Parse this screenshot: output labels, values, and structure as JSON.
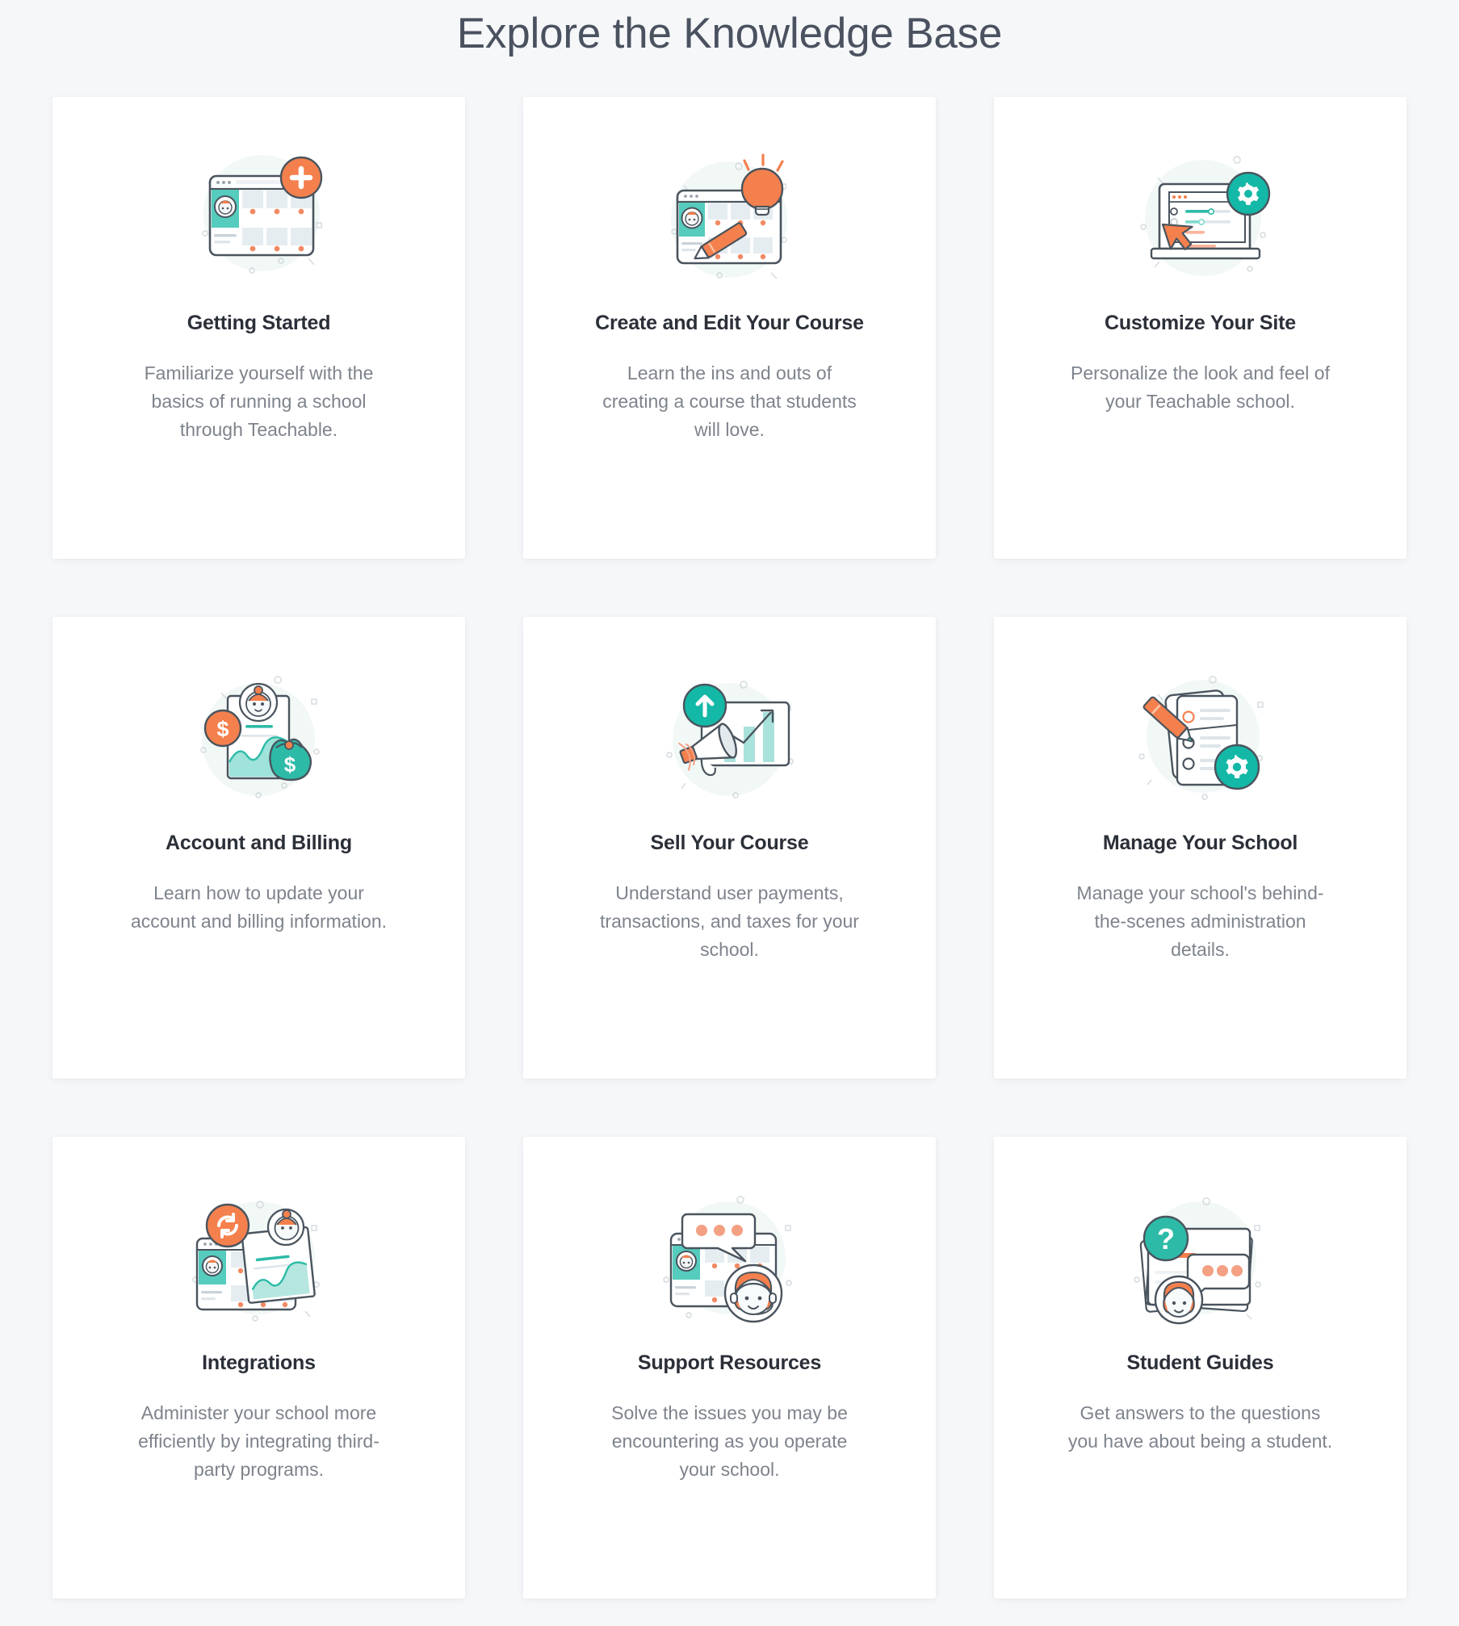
{
  "page": {
    "title": "Explore the Knowledge Base",
    "background_color": "#f6f7f9",
    "card_background_color": "#ffffff",
    "title_color": "#4a5260",
    "card_title_color": "#2b2f38",
    "card_desc_color": "#7e838c",
    "accent_orange": "#f4804d",
    "accent_teal": "#2dbba7",
    "accent_light_teal": "#7fd9cd",
    "outline_color": "#4a545e"
  },
  "cards": [
    {
      "title": "Getting Started",
      "description": "Familiarize yourself with the basics of running a school through Teachable.",
      "icon": "browser-window-with-plus-badge-illustration"
    },
    {
      "title": "Create and Edit Your Course",
      "description": "Learn the ins and outs of creating a course that students will love.",
      "icon": "browser-window-with-pencil-and-lightbulb-illustration"
    },
    {
      "title": "Customize Your Site",
      "description": "Personalize the look and feel of your Teachable school.",
      "icon": "laptop-with-gear-badge-and-cursor-illustration"
    },
    {
      "title": "Account and Billing",
      "description": "Learn how to update your account and billing information.",
      "icon": "invoice-with-coin-and-money-bag-illustration"
    },
    {
      "title": "Sell Your Course",
      "description": "Understand user payments, transactions, and taxes for your school.",
      "icon": "megaphone-with-growth-chart-and-up-arrow-badge-illustration"
    },
    {
      "title": "Manage Your School",
      "description": "Manage your school's behind-the-scenes administration details.",
      "icon": "clipboard-with-pencil-and-gear-badge-illustration"
    },
    {
      "title": "Integrations",
      "description": "Administer your school more efficiently by integrating third-party programs.",
      "icon": "browser-window-with-chart-document-and-sync-badge-illustration"
    },
    {
      "title": "Support Resources",
      "description": "Solve the issues you may be encountering as you operate your school.",
      "icon": "browser-window-with-speech-bubble-and-support-agent-illustration"
    },
    {
      "title": "Student Guides",
      "description": "Get answers to the questions you have about being a student.",
      "icon": "documents-with-question-badge-and-speech-bubble-illustration"
    }
  ]
}
